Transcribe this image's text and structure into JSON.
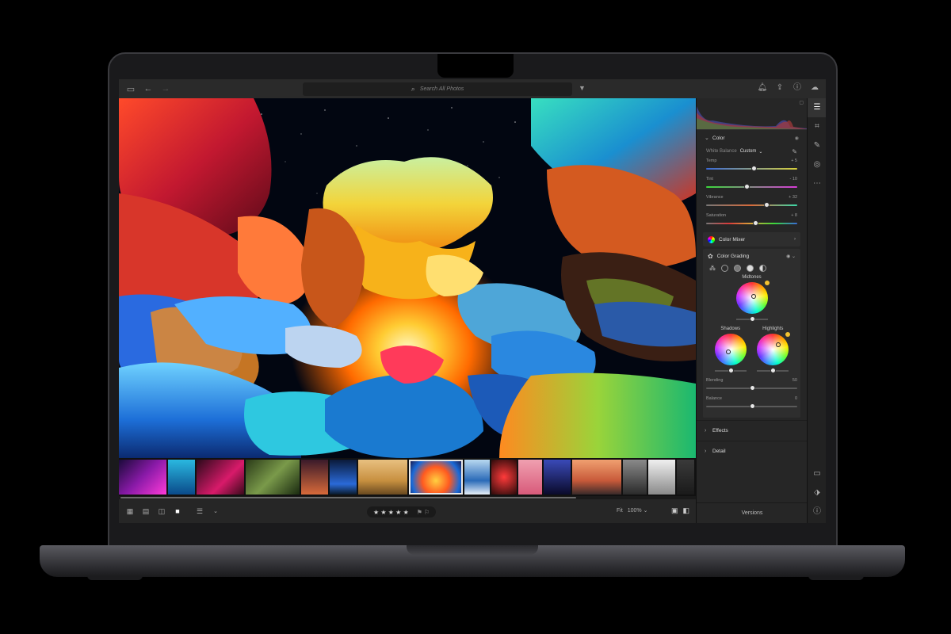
{
  "topbar": {
    "search_placeholder": "Search All Photos",
    "icons": [
      "sidebar-icon",
      "back-arrow-icon",
      "forward-arrow-icon",
      "filter-icon",
      "bell-icon",
      "share-icon",
      "help-icon",
      "cloud-icon"
    ]
  },
  "panel": {
    "color_section": "Color",
    "white_balance_label": "White Balance",
    "white_balance_value": "Custom",
    "sliders": [
      {
        "label": "Temp",
        "value": "+ 5",
        "position": 0.52,
        "track": "temp"
      },
      {
        "label": "Tint",
        "value": "- 10",
        "position": 0.44,
        "track": "tint"
      },
      {
        "label": "Vibrance",
        "value": "+ 32",
        "position": 0.66,
        "track": "vib"
      },
      {
        "label": "Saturation",
        "value": "+ 8",
        "position": 0.54,
        "track": "sat"
      }
    ],
    "color_mixer": "Color Mixer",
    "color_grading": "Color Grading",
    "midtones": "Midtones",
    "shadows": "Shadows",
    "highlights": "Highlights",
    "blending_label": "Blending",
    "blending_value": "50",
    "balance_label": "Balance",
    "balance_value": "0",
    "effects": "Effects",
    "detail": "Detail",
    "versions": "Versions"
  },
  "bottombar": {
    "rating_stars": "★ ★ ★ ★ ★",
    "fit_label": "Fit",
    "zoom": "100%"
  },
  "filmstrip": {
    "selected_index": 6,
    "scroll_fraction": 0.79
  },
  "colors": {
    "accent_badge": "#f2c230",
    "panel_bg": "#262626",
    "topbar_bg": "#2a2a2a"
  }
}
